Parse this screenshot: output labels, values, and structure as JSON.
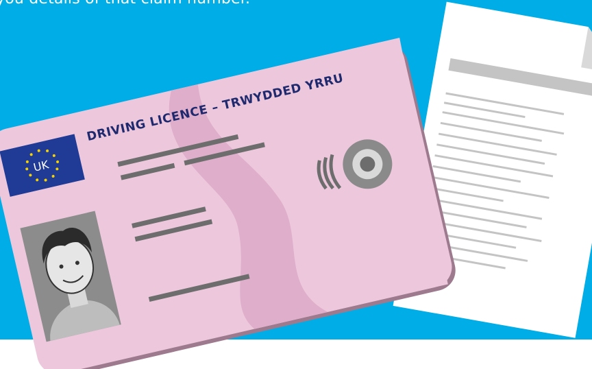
{
  "caption": "you details of that claim number.",
  "licence": {
    "title": "DRIVING LICENCE – TRWYDDED YRRU",
    "country_code": "UK"
  },
  "colors": {
    "banner": "#00ade6",
    "card": "#edc8dc",
    "card_wave": "#dfaecb",
    "flag": "#1f3b96",
    "stars": "#f5d100",
    "title_text": "#1f2a6e"
  },
  "icons": {
    "flag": "eu-flag-icon",
    "photo": "person-photo-icon",
    "chip": "contactless-chip-icon",
    "document": "document-icon"
  }
}
